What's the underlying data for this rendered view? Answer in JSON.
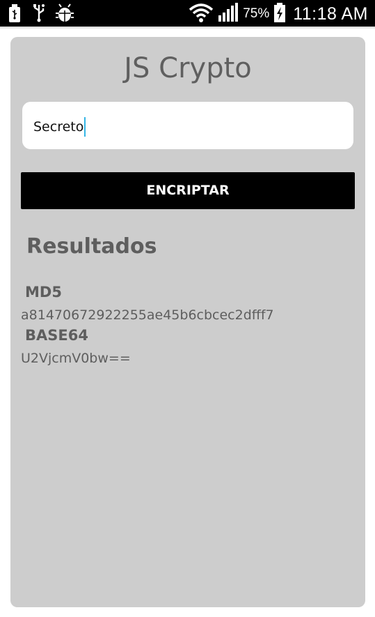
{
  "status_bar": {
    "left_icons": [
      "usb-icon",
      "usb-debug-icon",
      "android-debug-icon"
    ],
    "right_icons": [
      "wifi-icon",
      "signal-icon",
      "battery-charging-icon"
    ],
    "battery_percent": "75%",
    "time": "11:18 AM"
  },
  "app": {
    "title": "JS Crypto",
    "input_value": "Secreto",
    "encrypt_label": "ENCRIPTAR",
    "results_heading": "Resultados",
    "results": [
      {
        "label": "MD5",
        "value": "a81470672922255ae45b6cbcec2dfff7"
      },
      {
        "label": "BASE64",
        "value": "U2VjcmV0bw=="
      }
    ]
  },
  "colors": {
    "card_background": "#cdcdcd",
    "button_background": "#000000",
    "text_gray": "#5e5e5e",
    "caret": "#33b5e5"
  }
}
